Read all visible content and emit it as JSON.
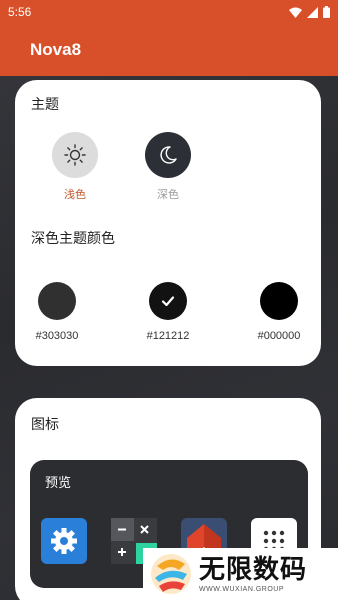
{
  "status_bar": {
    "time": "5:56"
  },
  "app_bar": {
    "title": "Nova8"
  },
  "theme_card": {
    "title": "主题",
    "modes": [
      {
        "label": "浅色",
        "icon": "sun-icon",
        "selected": true
      },
      {
        "label": "深色",
        "icon": "moon-icon",
        "selected": false
      }
    ],
    "dark_color_title": "深色主题颜色",
    "swatches": [
      {
        "label": "#303030",
        "color": "#303030",
        "selected": false
      },
      {
        "label": "#121212",
        "color": "#121212",
        "selected": true
      },
      {
        "label": "#000000",
        "color": "#000000",
        "selected": false
      }
    ]
  },
  "icon_card": {
    "title": "图标",
    "preview_title": "预览",
    "preview_icons": [
      "settings-app-icon",
      "calculator-app-icon",
      "launcher-home-app-icon",
      "app-drawer-icon"
    ]
  },
  "watermark": {
    "main": "无限数码",
    "sub": "WWW.WUXIAN.GROUP"
  },
  "colors": {
    "accent": "#d8502a",
    "selected_label": "#c0552b",
    "unselected_label": "#999999",
    "background": "#2b2c30"
  }
}
